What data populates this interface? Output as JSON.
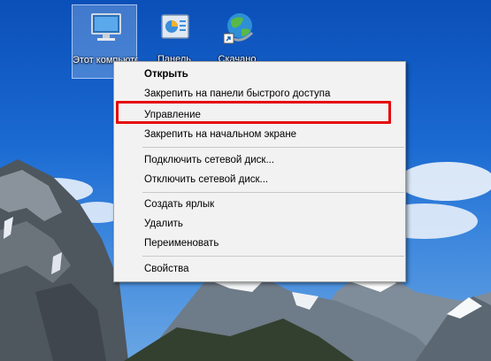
{
  "desktop": {
    "icons": [
      {
        "label": "Этот компьютер"
      },
      {
        "label": "Панель"
      },
      {
        "label": "Скачано"
      }
    ]
  },
  "context_menu": {
    "items": [
      {
        "label": "Открыть",
        "bold": true
      },
      {
        "label": "Закрепить на панели быстрого доступа"
      },
      {
        "label": "Управление",
        "highlighted": true
      },
      {
        "label": "Закрепить на начальном экране"
      },
      {
        "label": "Подключить сетевой диск..."
      },
      {
        "label": "Отключить сетевой диск..."
      },
      {
        "label": "Создать ярлык"
      },
      {
        "label": "Удалить"
      },
      {
        "label": "Переименовать"
      },
      {
        "label": "Свойства"
      }
    ]
  },
  "colors": {
    "highlight_border": "#e50b0b",
    "menu_background": "#f2f2f2"
  }
}
